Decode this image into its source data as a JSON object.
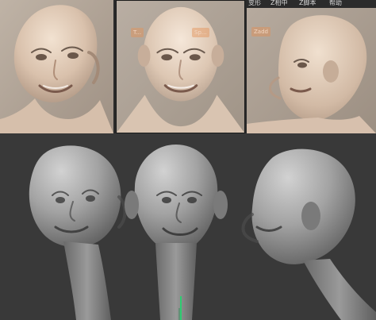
{
  "menu": {
    "items": [
      "变形",
      "Z相中",
      "Z脚本",
      "帮助"
    ]
  },
  "reference_ui": {
    "chip_left": "T...",
    "chip_mid": "Sp...",
    "chip_right": "Zadd"
  },
  "colors": {
    "skin_light": "#e6d3c2",
    "skin_mid": "#cdb29b",
    "skin_shadow": "#a28a77",
    "sculpt_light": "#b9b9b9",
    "sculpt_mid": "#8e8e8e",
    "sculpt_shadow": "#5c5c5c",
    "viewport_bg": "#393939",
    "axis_green": "#2ecc71",
    "ui_chip": "#e49155"
  },
  "viewport": {
    "axis_icon": "gizmo-axis"
  }
}
